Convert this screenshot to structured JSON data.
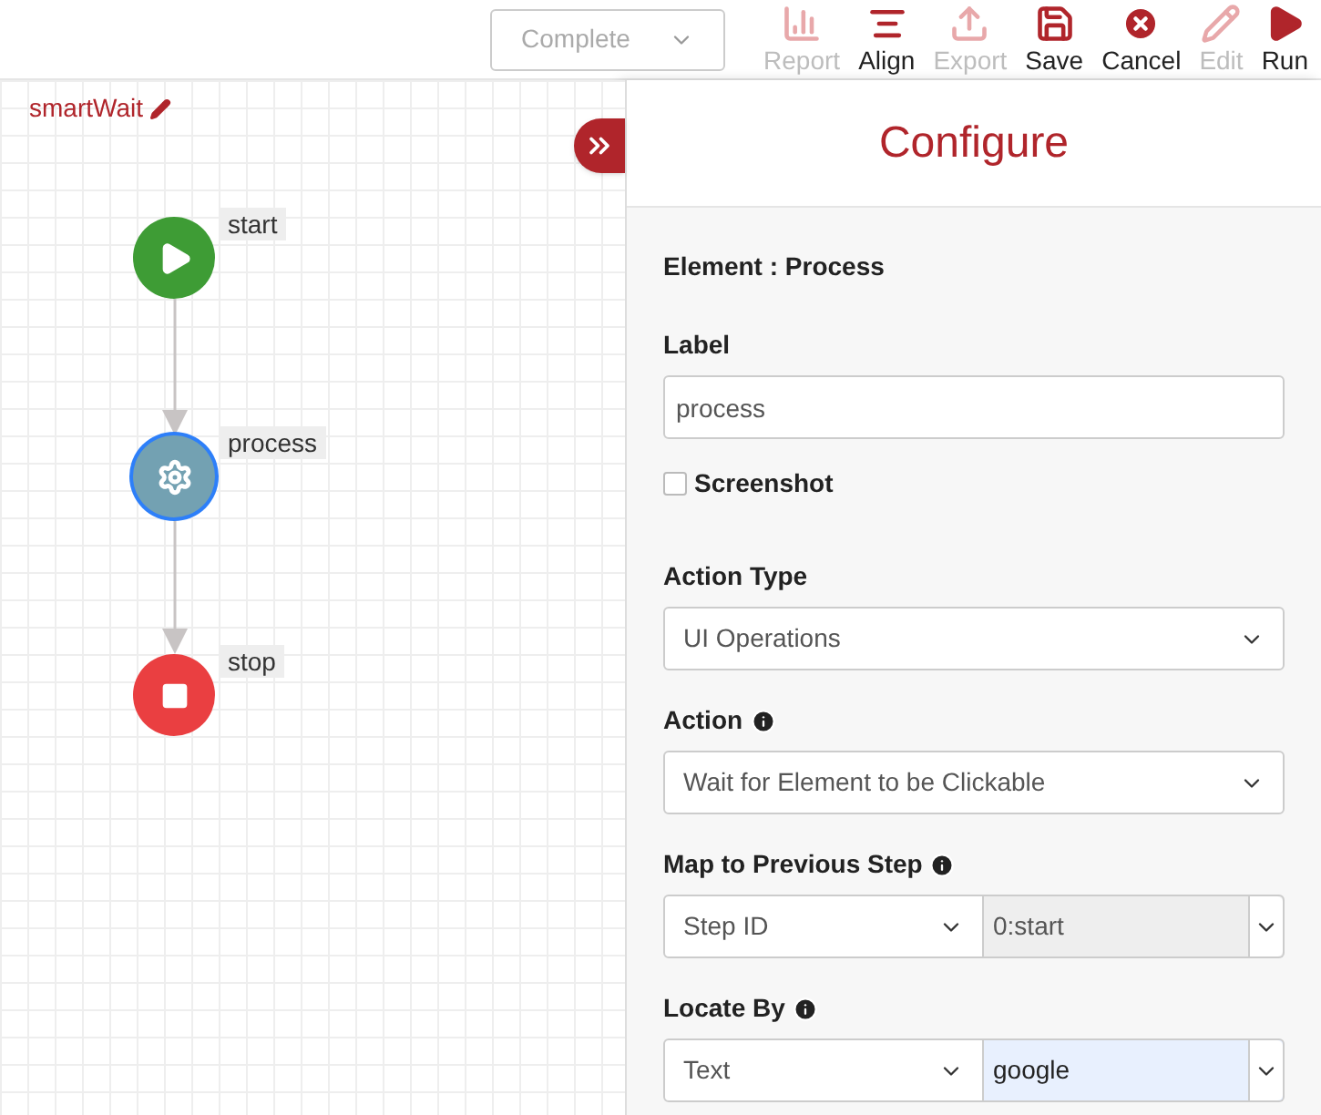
{
  "toolbar": {
    "status_select": {
      "value": "Complete",
      "disabled": true
    },
    "buttons": [
      {
        "kind": "report",
        "label": "Report",
        "disabled": true
      },
      {
        "kind": "align",
        "label": "Align",
        "disabled": false
      },
      {
        "kind": "export",
        "label": "Export",
        "disabled": true
      },
      {
        "kind": "save",
        "label": "Save",
        "disabled": false
      },
      {
        "kind": "cancel",
        "label": "Cancel",
        "disabled": false
      },
      {
        "kind": "edit",
        "label": "Edit",
        "disabled": true
      },
      {
        "kind": "run",
        "label": "Run",
        "disabled": false
      }
    ]
  },
  "canvas": {
    "title": "smartWait",
    "nodes": [
      {
        "kind": "start",
        "label": "start",
        "selected": false
      },
      {
        "kind": "process",
        "label": "process",
        "selected": true
      },
      {
        "kind": "stop",
        "label": "stop",
        "selected": false
      }
    ]
  },
  "panel": {
    "title": "Configure",
    "element": "Element : Process",
    "fields": [
      {
        "kind": "text",
        "label": "Label",
        "value": "process",
        "info": false
      },
      {
        "kind": "checkbox",
        "label": "Screenshot",
        "checked": false
      },
      {
        "kind": "select",
        "label": "Action Type",
        "value": "UI Operations",
        "info": false
      },
      {
        "kind": "select",
        "label": "Action",
        "value": "Wait for Element to be Clickable",
        "info": true
      },
      {
        "kind": "pair",
        "label": "Map to Previous Step",
        "value": "Step ID",
        "value2": "0:start",
        "disabled2": true,
        "highlight2": false,
        "info": true
      },
      {
        "kind": "pair",
        "label": "Locate By",
        "value": "Text",
        "value2": "google",
        "disabled2": false,
        "highlight2": true,
        "info": true
      }
    ]
  }
}
